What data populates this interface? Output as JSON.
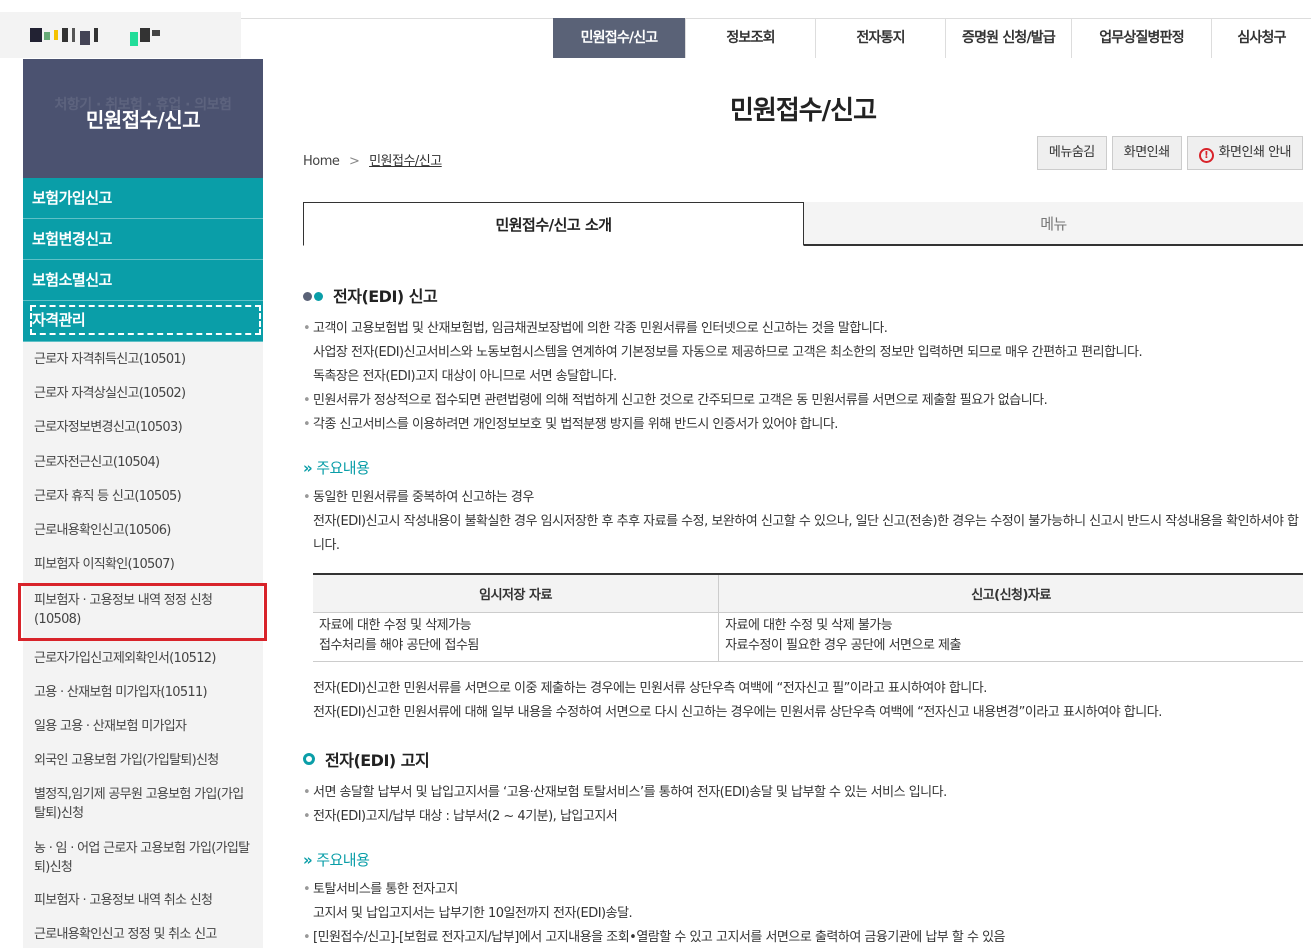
{
  "gnb": [
    "민원접수/신고",
    "정보조회",
    "전자통지",
    "증명원 신청/발급",
    "업무상질병판정",
    "심사청구"
  ],
  "sidebar": {
    "title": "민원접수/신고",
    "ghost_text": "처항기 · 취보험 · 휴업 · 의보험",
    "categories": [
      "보험가입신고",
      "보험변경신고",
      "보험소멸신고",
      "자격관리"
    ],
    "items": [
      "근로자 자격취득신고(10501)",
      "근로자 자격상실신고(10502)",
      "근로자정보변경신고(10503)",
      "근로자전근신고(10504)",
      "근로자 휴직 등 신고(10505)",
      "근로내용확인신고(10506)",
      "피보험자 이직확인(10507)",
      "피보험자 · 고용정보 내역 정정 신청 (10508)",
      "근로자가입신고제외확인서(10512)",
      "고용 · 산재보험 미가입자(10511)",
      "일용 고용 · 산재보험 미가입자",
      "외국인 고용보험 가입(가입탈퇴)신청",
      "별정직,임기제 공무원 고용보험 가입(가입탈퇴)신청",
      "농 · 임 · 어업 근로자 고용보험 가입(가입탈퇴)신청",
      "피보험자 · 고용정보 내역 취소 신청",
      "근로내용확인신고 정정 및 취소 신고"
    ]
  },
  "page": {
    "title": "민원접수/신고",
    "breadcrumb_home": "Home",
    "breadcrumb_sep": ">",
    "breadcrumb_current": "민원접수/신고",
    "btn_hide_menu": "메뉴숨김",
    "btn_print": "화면인쇄",
    "btn_print_guide": "화면인쇄 안내",
    "tab_intro": "민원접수/신고 소개",
    "tab_menu": "메뉴"
  },
  "section1": {
    "heading": "전자(EDI) 신고",
    "lines": [
      "고객이 고용보험법 및 산재보험법, 임금채권보장법에 의한 각종 민원서류를 인터넷으로 신고하는 것을 말합니다.",
      "사업장 전자(EDI)신고서비스와 노동보험시스템을 연계하여 기본정보를 자동으로 제공하므로 고객은 최소한의 정보만 입력하면 되므로 매우 간편하고 편리합니다.",
      "독촉장은 전자(EDI)고지 대상이 아니므로 서면 송달합니다.",
      "민원서류가 정상적으로 접수되면 관련법령에 의해 적법하게 신고한 것으로 간주되므로 고객은 동 민원서류를 서면으로 제출할 필요가 없습니다.",
      "각종 신고서비스를 이용하려면 개인정보보호 및 법적분쟁 방지를 위해 반드시 인증서가 있어야 합니다."
    ],
    "sub_heading": "주요내용",
    "sub_lines": [
      "동일한 민원서류를 중복하여 신고하는 경우",
      "전자(EDI)신고시 작성내용이 불확실한 경우 임시저장한 후 추후 자료를 수정, 보완하여 신고할 수 있으나, 일단 신고(전송)한 경우는 수정이 불가능하니 신고시 반드시 작성내용을 확인하셔야 합니다."
    ],
    "table_headers": [
      "임시저장 자료",
      "신고(신청)자료"
    ],
    "table_col1": [
      "자료에 대한 수정 및 삭제가능",
      "접수처리를 해야 공단에 접수됨"
    ],
    "table_col2": [
      "자료에 대한 수정 및 삭제 불가능",
      "자료수정이 필요한 경우 공단에 서면으로 제출"
    ],
    "notes": [
      "전자(EDI)신고한 민원서류를 서면으로 이중 제출하는 경우에는 민원서류 상단우측 여백에 “전자신고 필”이라고 표시하여야 합니다.",
      "전자(EDI)신고한 민원서류에 대해 일부 내용을 수정하여 서면으로 다시 신고하는 경우에는 민원서류 상단우측 여백에 “전자신고 내용변경”이라고 표시하여야 합니다."
    ]
  },
  "section2": {
    "heading": "전자(EDI) 고지",
    "lines": [
      "서면 송달할 납부서 및 납입고지서를 ‘고용·산재보험 토탈서비스’를 통하여 전자(EDI)송달 및 납부할 수 있는 서비스 입니다.",
      "전자(EDI)고지/납부 대상 : 납부서(2 ~ 4기분), 납입고지서"
    ],
    "sub_heading": "주요내용",
    "sub_lines": [
      "토탈서비스를 통한 전자고지",
      "고지서 및 납입고지서는 납부기한 10일전까지 전자(EDI)송달.",
      "[민원접수/신고]-[보험료 전자고지/납부]에서 고지내용을 조회•열람할 수 있고 고지서를 서면으로 출력하여 금융기관에 납부 할 수 있음"
    ]
  },
  "colors": {
    "accent": "#0a9ea8",
    "nav_dark": "#5a6277",
    "sidebar_head": "#4b5270",
    "highlight": "#d8232a"
  }
}
